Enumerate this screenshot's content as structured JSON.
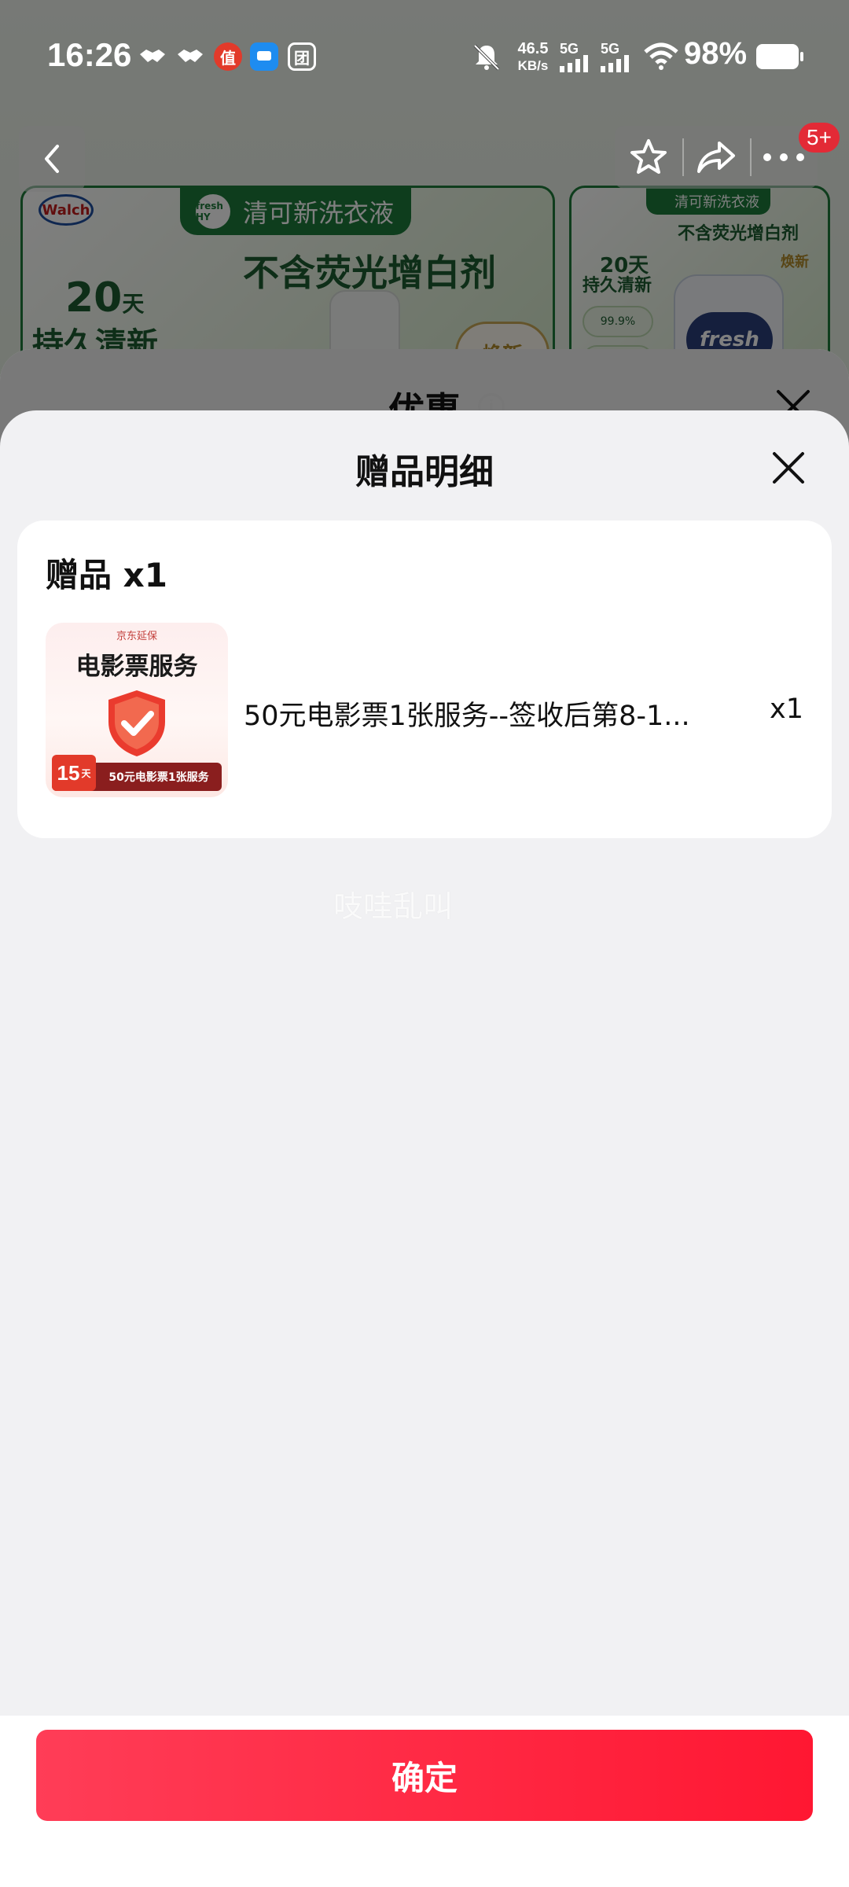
{
  "status_bar": {
    "time": "16:26",
    "net_speed_value": "46.5",
    "net_speed_unit": "KB/s",
    "sim1": "5G",
    "sim2": "5G",
    "battery": "98%"
  },
  "background": {
    "banner1": {
      "brand": "Walch",
      "tag": "清可新洗衣液",
      "tag_logo": "fresh HY",
      "headline": "不含荧光增白剂",
      "days": "20",
      "days_unit": "天",
      "fresh": "持久清新",
      "new": "焕新"
    },
    "banner2": {
      "tag": "清可新洗衣液",
      "headline": "不含荧光增白剂",
      "days": "20天",
      "fresh": "持久清新",
      "new": "焕新",
      "pct": "99.9%",
      "logo": "fresh"
    },
    "badge": "5+",
    "prev_sheet_title": "优惠"
  },
  "sheet": {
    "title": "赠品明细",
    "card_title": "赠品 x1",
    "gift": {
      "image_brand": "京东延保",
      "image_service": "电影票服务",
      "image_days": "15",
      "image_days_unit": "天",
      "image_tag": "50元电影票1张服务",
      "name": "50元电影票1张服务--签收后第8-1...",
      "qty": "x1"
    },
    "watermark": "吱哇乱叫",
    "confirm_label": "确定"
  },
  "colors": {
    "accent": "#ff2442",
    "banner_green": "#1d7a3a",
    "sheet_bg": "#f1f1f3"
  }
}
